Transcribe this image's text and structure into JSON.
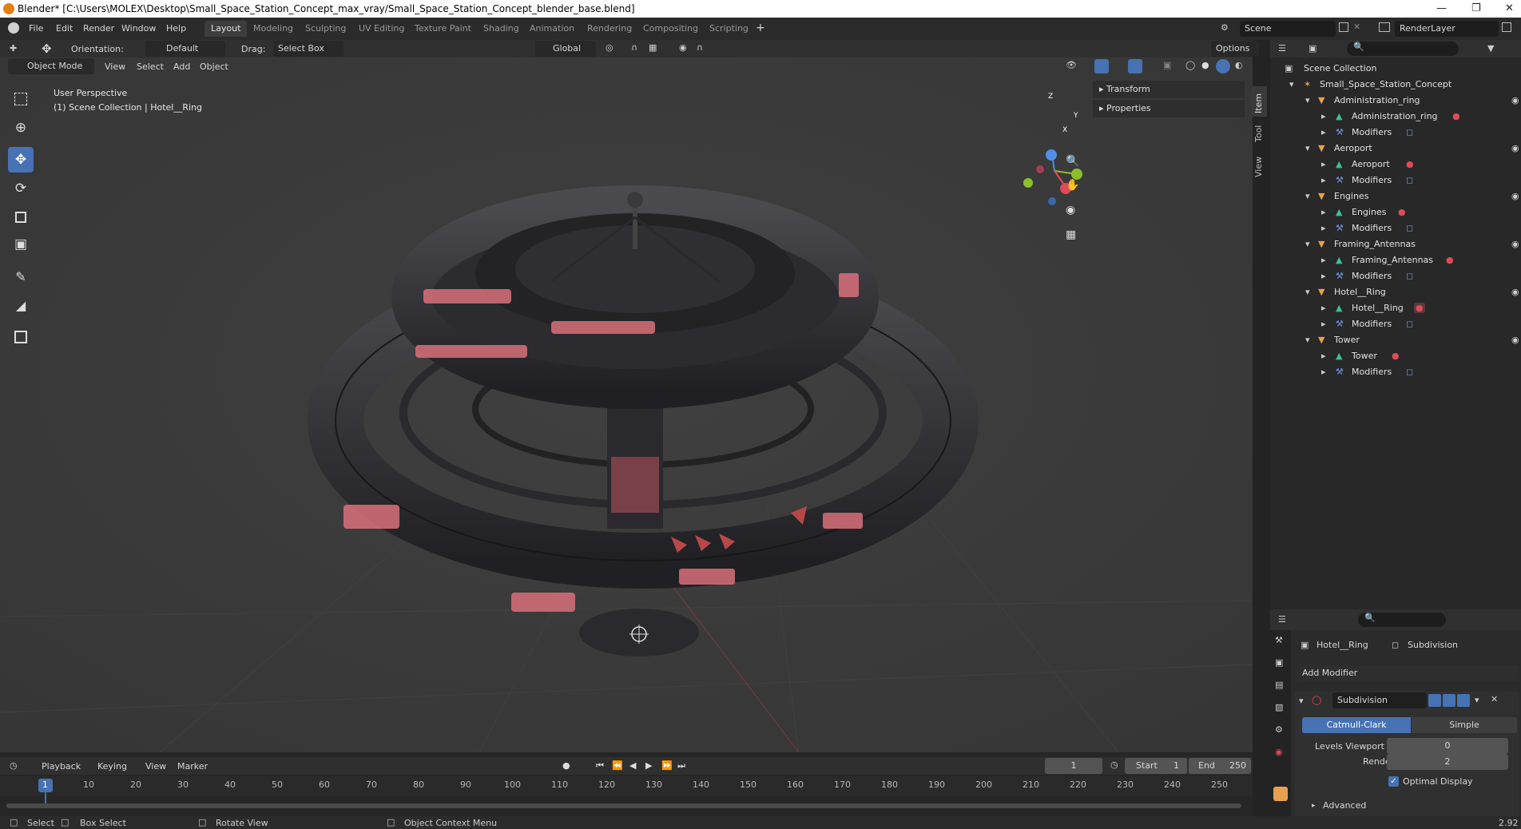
{
  "window": {
    "title": "Blender* [C:\\Users\\MOLEX\\Desktop\\Small_Space_Station_Concept_max_vray/Small_Space_Station_Concept_blender_base.blend]"
  },
  "menu": [
    "File",
    "Edit",
    "Render",
    "Window",
    "Help"
  ],
  "workspaces": [
    "Layout",
    "Modeling",
    "Sculpting",
    "UV Editing",
    "Texture Paint",
    "Shading",
    "Animation",
    "Rendering",
    "Compositing",
    "Scripting"
  ],
  "workspace_add": "+",
  "scene": {
    "name": "Scene",
    "render_layer": "RenderLayer"
  },
  "viewport_header": {
    "orientation_label": "Orientation:",
    "orientation_value": "Default",
    "drag_label": "Drag:",
    "drag_value": "Select Box",
    "transform_space": "Global",
    "options": "Options",
    "mode": "Object Mode",
    "menus": [
      "View",
      "Select",
      "Add",
      "Object"
    ]
  },
  "viewport": {
    "perspective": "User Perspective",
    "context": "(1) Scene Collection | Hotel__Ring",
    "gizmo_axes": [
      "X",
      "Y",
      "Z"
    ]
  },
  "npanel": {
    "rows": [
      "Transform",
      "Properties"
    ],
    "tabs": [
      "Item",
      "Tool",
      "View"
    ]
  },
  "outliner": {
    "root": "Scene Collection",
    "scene_object": "Small_Space_Station_Concept",
    "items": [
      {
        "name": "Administration_ring",
        "mesh": "Administration_ring",
        "mod": "Modifiers"
      },
      {
        "name": "Aeroport",
        "mesh": "Aeroport",
        "mod": "Modifiers"
      },
      {
        "name": "Engines",
        "mesh": "Engines",
        "mod": "Modifiers"
      },
      {
        "name": "Framing_Antennas",
        "mesh": "Framing_Antennas",
        "mod": "Modifiers"
      },
      {
        "name": "Hotel__Ring",
        "mesh": "Hotel__Ring",
        "mod": "Modifiers"
      },
      {
        "name": "Tower",
        "mesh": "Tower",
        "mod": "Modifiers"
      }
    ]
  },
  "properties": {
    "object_name": "Hotel__Ring",
    "modifier_tab": "Subdivision",
    "add_modifier": "Add Modifier",
    "modifier_name": "Subdivision",
    "algorithms": [
      "Catmull-Clark",
      "Simple"
    ],
    "levels_viewport_label": "Levels Viewport",
    "levels_viewport": "0",
    "render_label": "Render",
    "render_value": "2",
    "optimal_display": "Optimal Display",
    "advanced": "Advanced",
    "version": "2.92"
  },
  "timeline": {
    "menus": [
      "Playback",
      "Keying",
      "View",
      "Marker"
    ],
    "current_frame": "1",
    "start_label": "Start",
    "start": "1",
    "end_label": "End",
    "end": "250",
    "ticks": [
      "1",
      "10",
      "20",
      "30",
      "40",
      "50",
      "60",
      "70",
      "80",
      "90",
      "100",
      "110",
      "120",
      "130",
      "140",
      "150",
      "160",
      "170",
      "180",
      "190",
      "200",
      "210",
      "220",
      "230",
      "240",
      "250"
    ]
  },
  "status": {
    "select": "Select",
    "box_select": "Box Select",
    "rotate": "Rotate View",
    "context_menu": "Object Context Menu"
  },
  "colors": {
    "accent": "#4772b3",
    "viewport_bg": "#3b3b3b",
    "selected_row": "#334d80"
  }
}
